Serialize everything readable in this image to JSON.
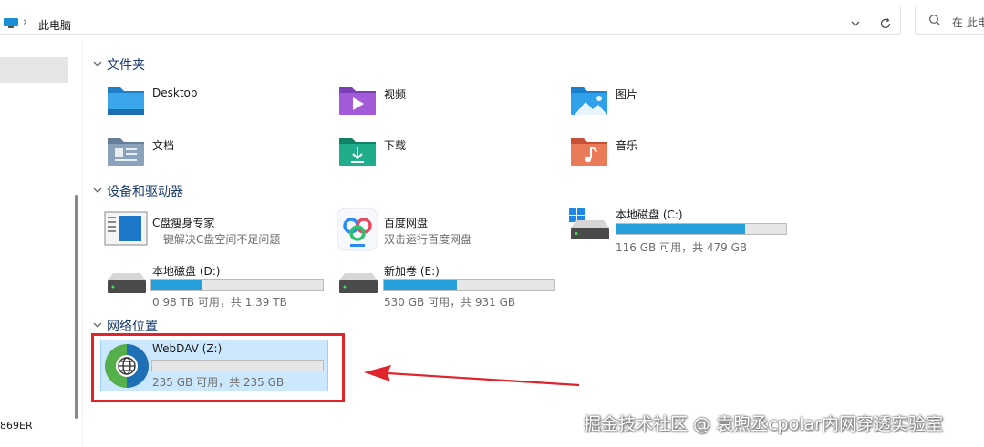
{
  "address_bar": {
    "breadcrumb": "此电脑",
    "separator": "›"
  },
  "search": {
    "placeholder": "在 此电"
  },
  "sidebar": {
    "drive_label": "869ER"
  },
  "sections": {
    "folders": {
      "title": "文件夹"
    },
    "devices": {
      "title": "设备和驱动器"
    },
    "network": {
      "title": "网络位置"
    }
  },
  "folders": [
    {
      "name": "Desktop",
      "icon": "desktop-folder-icon"
    },
    {
      "name": "视频",
      "icon": "videos-folder-icon"
    },
    {
      "name": "图片",
      "icon": "pictures-folder-icon"
    },
    {
      "name": "文档",
      "icon": "documents-folder-icon"
    },
    {
      "name": "下载",
      "icon": "downloads-folder-icon"
    },
    {
      "name": "音乐",
      "icon": "music-folder-icon"
    }
  ],
  "devices": {
    "c_disk_app": {
      "name": "C盘瘦身专家",
      "description": "一键解决C盘空间不足问题"
    },
    "baidu": {
      "name": "百度网盘",
      "description": "双击运行百度网盘"
    },
    "drive_c": {
      "name": "本地磁盘 (C:)",
      "space": "116 GB 可用，共 479 GB",
      "used_fraction": 0.76
    },
    "drive_d": {
      "name": "本地磁盘 (D:)",
      "space": "0.98 TB 可用，共 1.39 TB",
      "used_fraction": 0.3
    },
    "drive_e": {
      "name": "新加卷 (E:)",
      "space": "530 GB 可用，共 931 GB",
      "used_fraction": 0.43
    }
  },
  "network": {
    "webdav": {
      "name": "WebDAV (Z:)",
      "space": "235 GB 可用，共 235 GB",
      "used_fraction": 0.0
    }
  },
  "watermark": "掘金技术社区 @ 袁煦丞cpolar内网穿透实验室",
  "colors": {
    "accent": "#26a0da",
    "selection": "#cce8ff",
    "highlight_red": "#e0242b"
  }
}
